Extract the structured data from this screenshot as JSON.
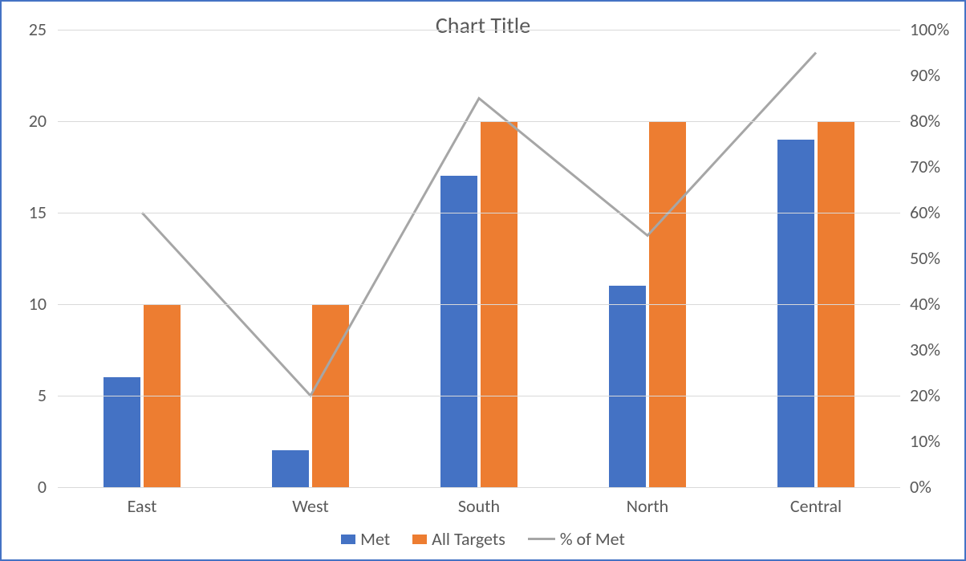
{
  "chart_data": {
    "type": "bar+line",
    "title": "Chart Title",
    "categories": [
      "East",
      "West",
      "South",
      "North",
      "Central"
    ],
    "series": [
      {
        "name": "Met",
        "kind": "bar",
        "axis": "left",
        "color": "#4472C4",
        "values": [
          6,
          2,
          17,
          11,
          19
        ]
      },
      {
        "name": "All Targets",
        "kind": "bar",
        "axis": "left",
        "color": "#ED7D31",
        "values": [
          10,
          10,
          20,
          20,
          20
        ]
      },
      {
        "name": "% of Met",
        "kind": "line",
        "axis": "right",
        "color": "#A6A6A6",
        "values": [
          60,
          20,
          85,
          55,
          95
        ]
      }
    ],
    "left_axis": {
      "min": 0,
      "max": 25,
      "step": 5,
      "format": "number"
    },
    "right_axis": {
      "min": 0,
      "max": 100,
      "step": 10,
      "format": "percent"
    },
    "left_ticks": [
      "0",
      "5",
      "10",
      "15",
      "20",
      "25"
    ],
    "right_ticks": [
      "0%",
      "10%",
      "20%",
      "30%",
      "40%",
      "50%",
      "60%",
      "70%",
      "80%",
      "90%",
      "100%"
    ],
    "grid": true,
    "legend_position": "bottom"
  }
}
